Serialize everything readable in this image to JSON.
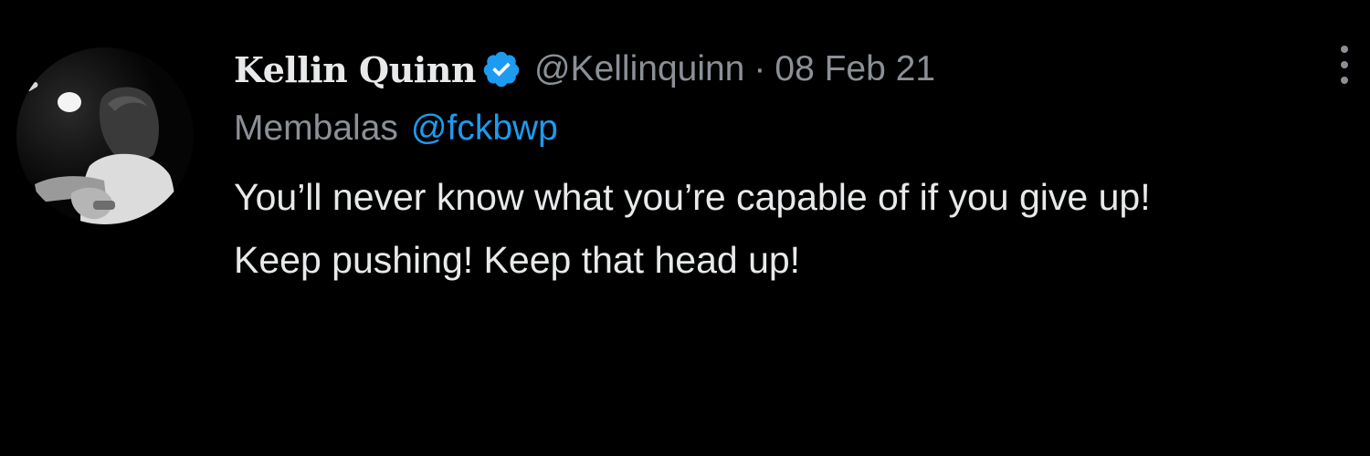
{
  "author": {
    "display_name": "Kellin Quinn",
    "handle": "@Kellinquinn",
    "separator": "·",
    "date": "08 Feb 21",
    "verified_icon": "verified-badge-icon",
    "avatar_icon": "avatar-photo"
  },
  "reply": {
    "prefix": "Membalas",
    "mention": "@fckbwp"
  },
  "tweet": {
    "text": "You’ll never know what you’re capable of if you give up!\nKeep pushing! Keep that head up!"
  },
  "menu": {
    "icon": "more-vertical-icon"
  },
  "colors": {
    "background": "#000000",
    "primary_text": "#e7e9ea",
    "secondary_text": "#8b9097",
    "accent": "#1d9bf0"
  }
}
